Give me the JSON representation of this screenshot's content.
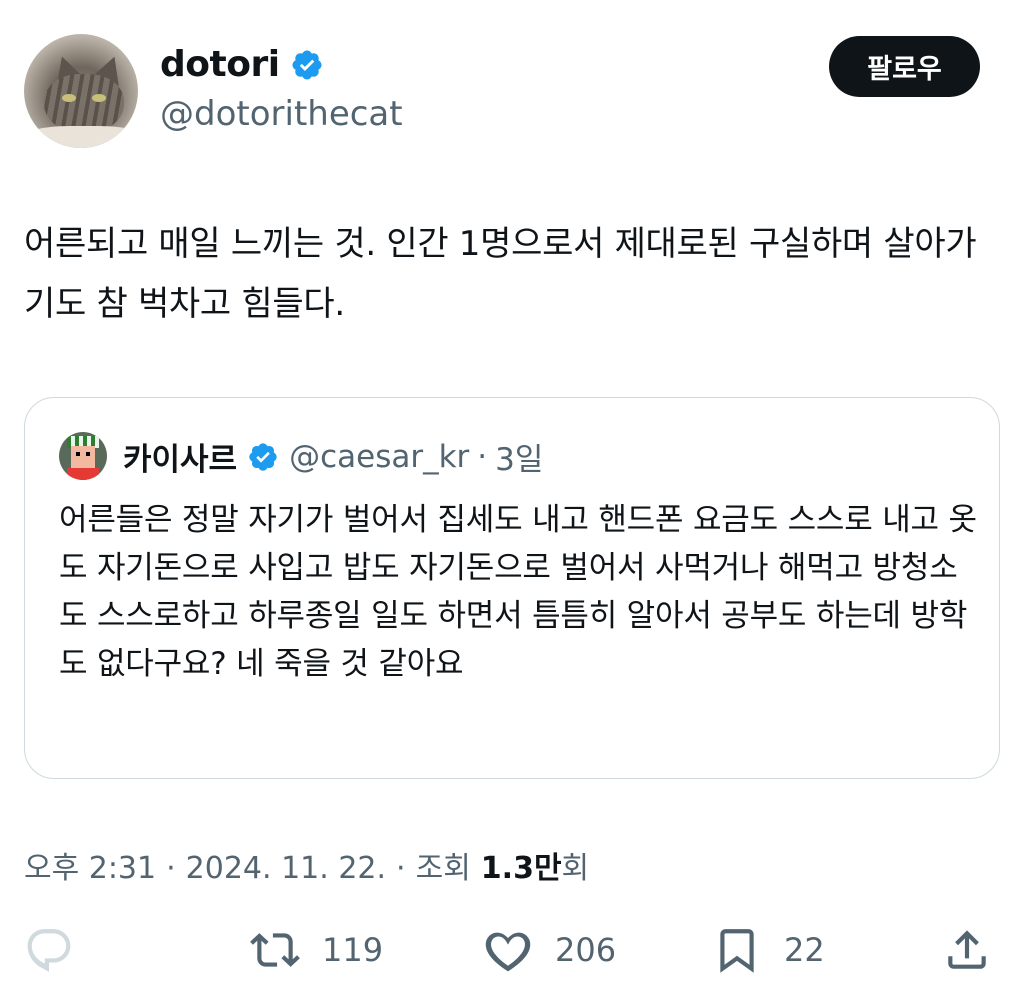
{
  "author": {
    "name": "dotori",
    "handle": "@dotorithecat",
    "follow_label": "팔로우"
  },
  "tweet": {
    "text": "어른되고 매일 느끼는 것. 인간 1명으로서 제대로된 구실하며 살아가기도 참 벅차고 힘들다."
  },
  "quote": {
    "name": "카이사르",
    "handle": "@caesar_kr",
    "separator": "·",
    "time": "3일",
    "text": "어른들은 정말 자기가 벌어서 집세도 내고 핸드폰 요금도 스스로 내고 옷도 자기돈으로 사입고 밥도 자기돈으로 벌어서 사먹거나 해먹고 방청소도 스스로하고 하루종일 일도 하면서 틈틈히 알아서 공부도 하는데 방학도 없다구요? 네 죽을 것 같아요"
  },
  "meta": {
    "time": "오후 2:31",
    "date": "2024. 11. 22.",
    "views_label": "조회",
    "views_count": "1.3만",
    "views_suffix": "회",
    "sep": "·"
  },
  "actions": {
    "reply_icon": "reply-icon",
    "retweet_icon": "retweet-icon",
    "retweet_count": "119",
    "like_icon": "heart-icon",
    "like_count": "206",
    "bookmark_icon": "bookmark-icon",
    "bookmark_count": "22",
    "share_icon": "share-icon"
  },
  "colors": {
    "text": "#0f1419",
    "secondary": "#536471",
    "verified": "#1d9bf0",
    "border": "#cfd9de",
    "button_bg": "#0f1419"
  }
}
